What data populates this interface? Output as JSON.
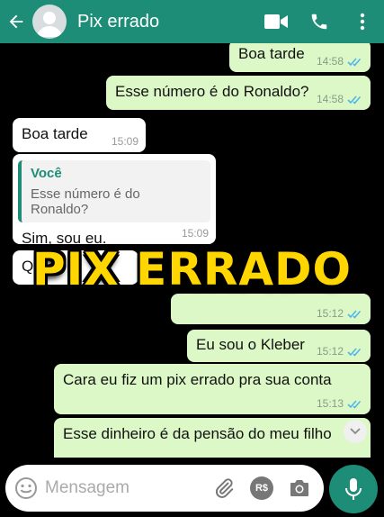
{
  "header": {
    "title": "Pix errado",
    "back_icon": "arrow-left-icon",
    "video_icon": "video-camera-icon",
    "call_icon": "phone-icon",
    "menu_icon": "more-vert-icon",
    "bg_color": "#1e8d77"
  },
  "messages": [
    {
      "text": "Boa tarde",
      "time": "14:58",
      "dir": "out",
      "status": "read"
    },
    {
      "text": "Esse número é do Ronaldo?",
      "time": "14:58",
      "dir": "out",
      "status": "read"
    },
    {
      "text": "Boa tarde",
      "time": "15:09",
      "dir": "in"
    },
    {
      "quote_author": "Você",
      "quote_text": "Esse número é do Ronaldo?",
      "text": "Sim, sou eu.",
      "time": "15:09",
      "dir": "in"
    },
    {
      "text": "Q",
      "dir": "in"
    },
    {
      "time": "15:12",
      "dir": "out",
      "status": "read"
    },
    {
      "text": "Eu sou o Kleber",
      "time": "15:12",
      "dir": "out",
      "status": "read"
    },
    {
      "text": "Cara eu fiz um pix errado pra sua conta",
      "time": "15:13",
      "dir": "out",
      "status": "read"
    },
    {
      "text": "Esse dinheiro é da pensão do meu filho",
      "dir": "out"
    }
  ],
  "overlay_caption": "PIX ERRADO",
  "input": {
    "placeholder": "Mensagem",
    "emoji_icon": "emoji-icon",
    "attach_icon": "paperclip-icon",
    "payment_icon": "pix-payment-icon",
    "payment_label": "R$",
    "camera_icon": "camera-icon",
    "mic_icon": "microphone-icon"
  },
  "colors": {
    "outgoing_bubble": "#dcf8c6",
    "incoming_bubble": "#ffffff",
    "read_ticks": "#4fb6ec",
    "accent": "#1e8d77"
  }
}
